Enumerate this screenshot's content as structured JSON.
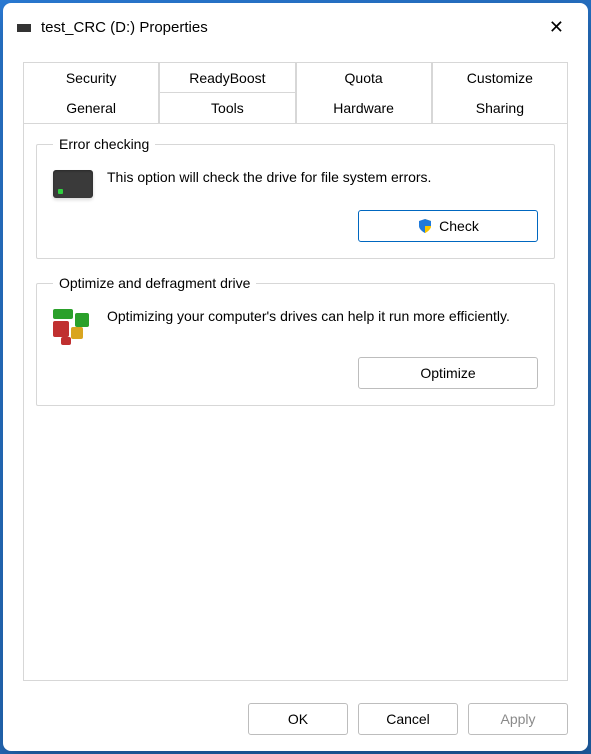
{
  "title": "test_CRC (D:) Properties",
  "tabs_top": [
    "Security",
    "ReadyBoost",
    "Quota",
    "Customize"
  ],
  "tabs_bottom": [
    "General",
    "Tools",
    "Hardware",
    "Sharing"
  ],
  "active_tab": "Tools",
  "groups": {
    "error": {
      "legend": "Error checking",
      "desc": "This option will check the drive for file system errors.",
      "button": "Check"
    },
    "optimize": {
      "legend": "Optimize and defragment drive",
      "desc": "Optimizing your computer's drives can help it run more efficiently.",
      "button": "Optimize"
    }
  },
  "footer": {
    "ok": "OK",
    "cancel": "Cancel",
    "apply": "Apply"
  }
}
